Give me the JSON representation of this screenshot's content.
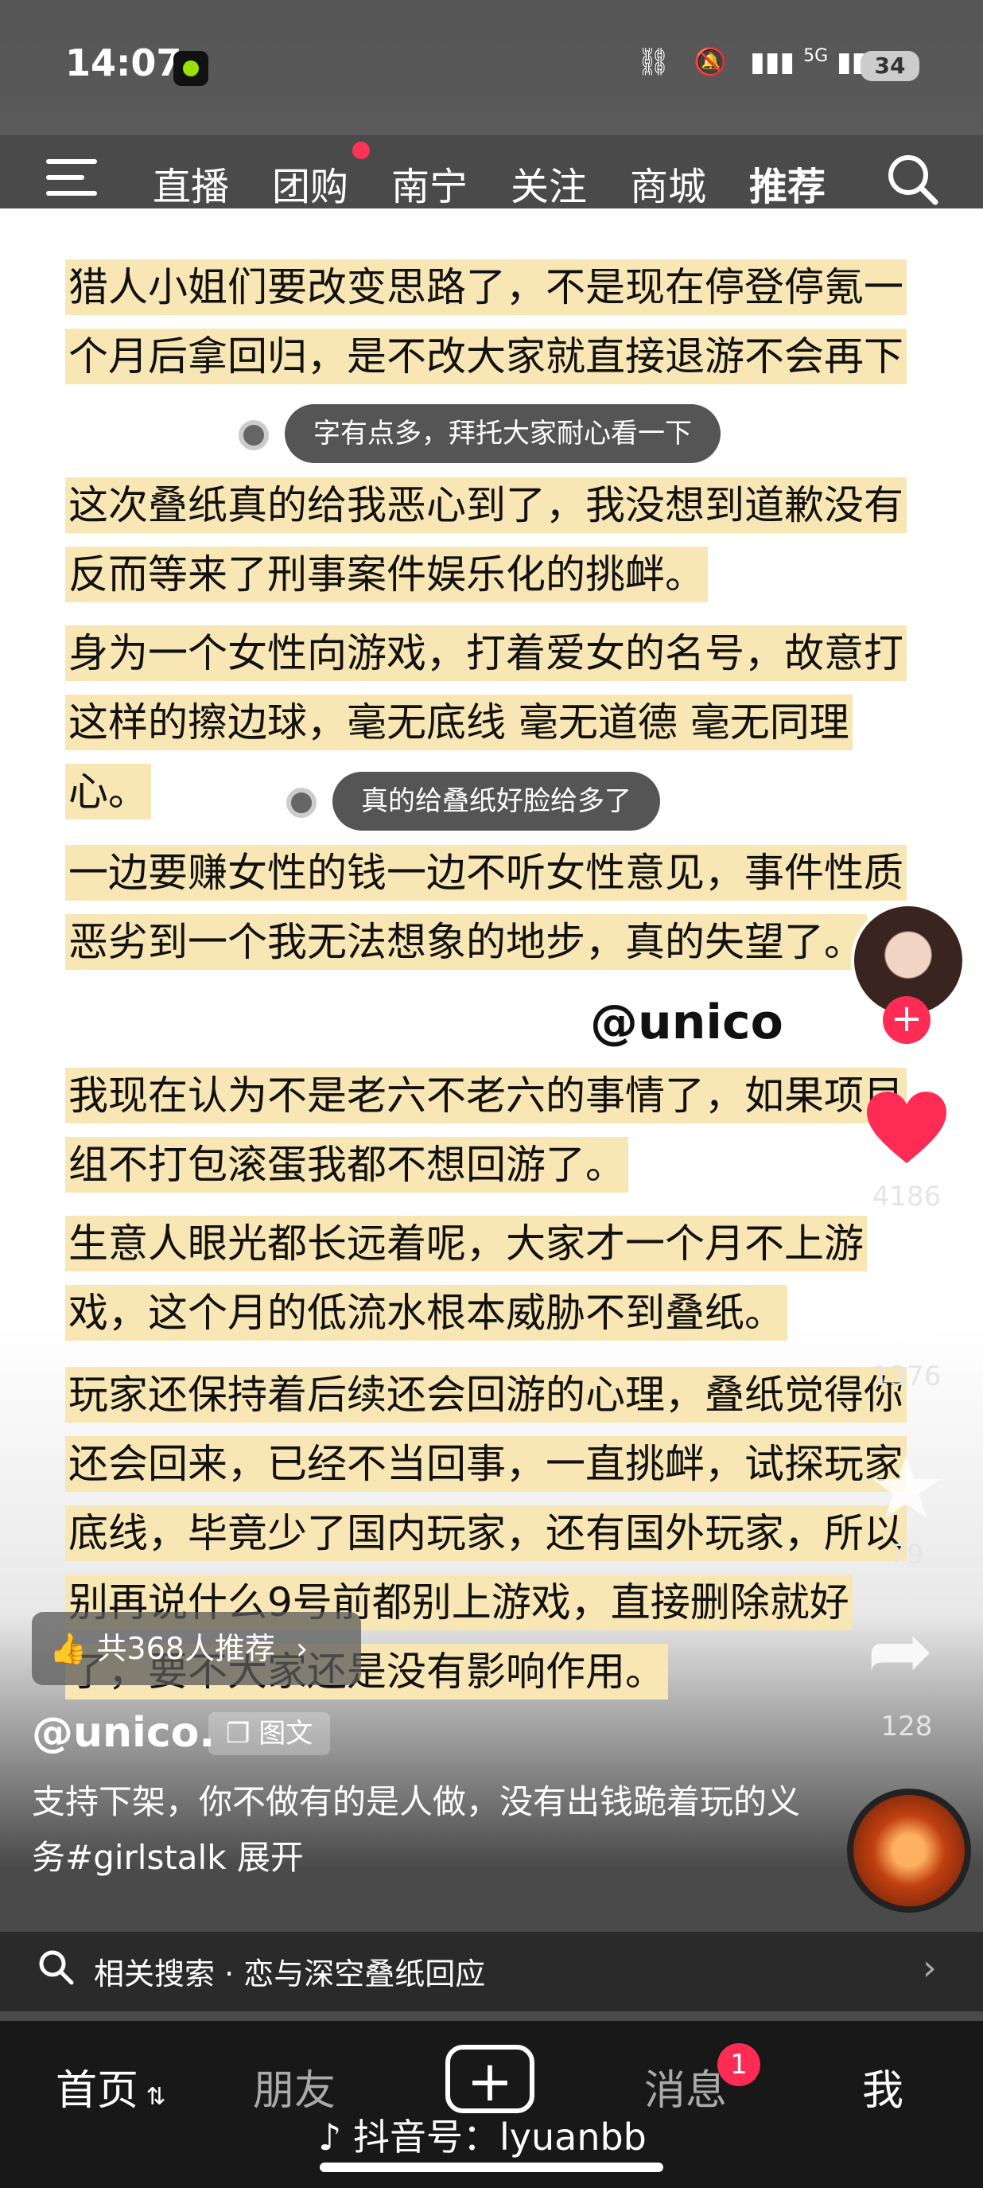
{
  "status_bar": {
    "time": "14:07",
    "network": "5G",
    "battery": "34"
  },
  "top_nav": {
    "tabs": [
      "直播",
      "团购",
      "南宁",
      "关注",
      "商城",
      "推荐"
    ],
    "active_tab": "推荐"
  },
  "post": {
    "paragraphs": [
      "猎人小姐们要改变思路了，不是现在停登停氪一个月后拿回归，是不改大家就直接退游不会再下",
      "这次叠纸真的给我恶心到了，我没想到道歉没有反而等来了刑事案件娱乐化的挑衅。",
      "身为一个女性向游戏，打着爱女的名号，故意打这样的擦边球，毫无底线 毫无道德 毫无同理心。",
      "一边要赚女性的钱一边不听女性意见，事件性质恶劣到一个我无法想象的地步，真的失望了。",
      "我现在认为不是老六不老六的事情了，如果项目组不打包滚蛋我都不想回游了。",
      "生意人眼光都长远着呢，大家才一个月不上游戏，这个月的低流水根本威胁不到叠纸。",
      "玩家还保持着后续还会回游的心理，叠纸觉得你还会回来，已经不当回事，一直挑衅，试探玩家底线，毕竟少了国内玩家，还有国外玩家，所以别再说什么9号前都别上游戏，直接删除就好了，要不大家还是没有影响作用。"
    ],
    "bubble_1": "字有点多，拜托大家耐心看一下",
    "bubble_2": "真的给叠纸好脸给多了",
    "watermark": "@unico"
  },
  "actions": {
    "likes": "4186",
    "comments": "1376",
    "favorites": "79",
    "shares": "128"
  },
  "info": {
    "recommend_pill": "共368人推荐",
    "author": "@unico.",
    "type_label": "图文",
    "description": "支持下架，你不做有的是人做，没有出钱跪着玩的义务#girlstalk  展开",
    "related_search": "相关搜索 · 恋与深空叠纸回应"
  },
  "tab_bar": {
    "home": "首页",
    "friends": "朋友",
    "messages": "消息",
    "messages_badge": "1",
    "me": "我"
  },
  "footer_id": "抖音号：lyuanbb",
  "colors": {
    "highlight": "#f8e7b4",
    "accent": "#fe2c55"
  }
}
